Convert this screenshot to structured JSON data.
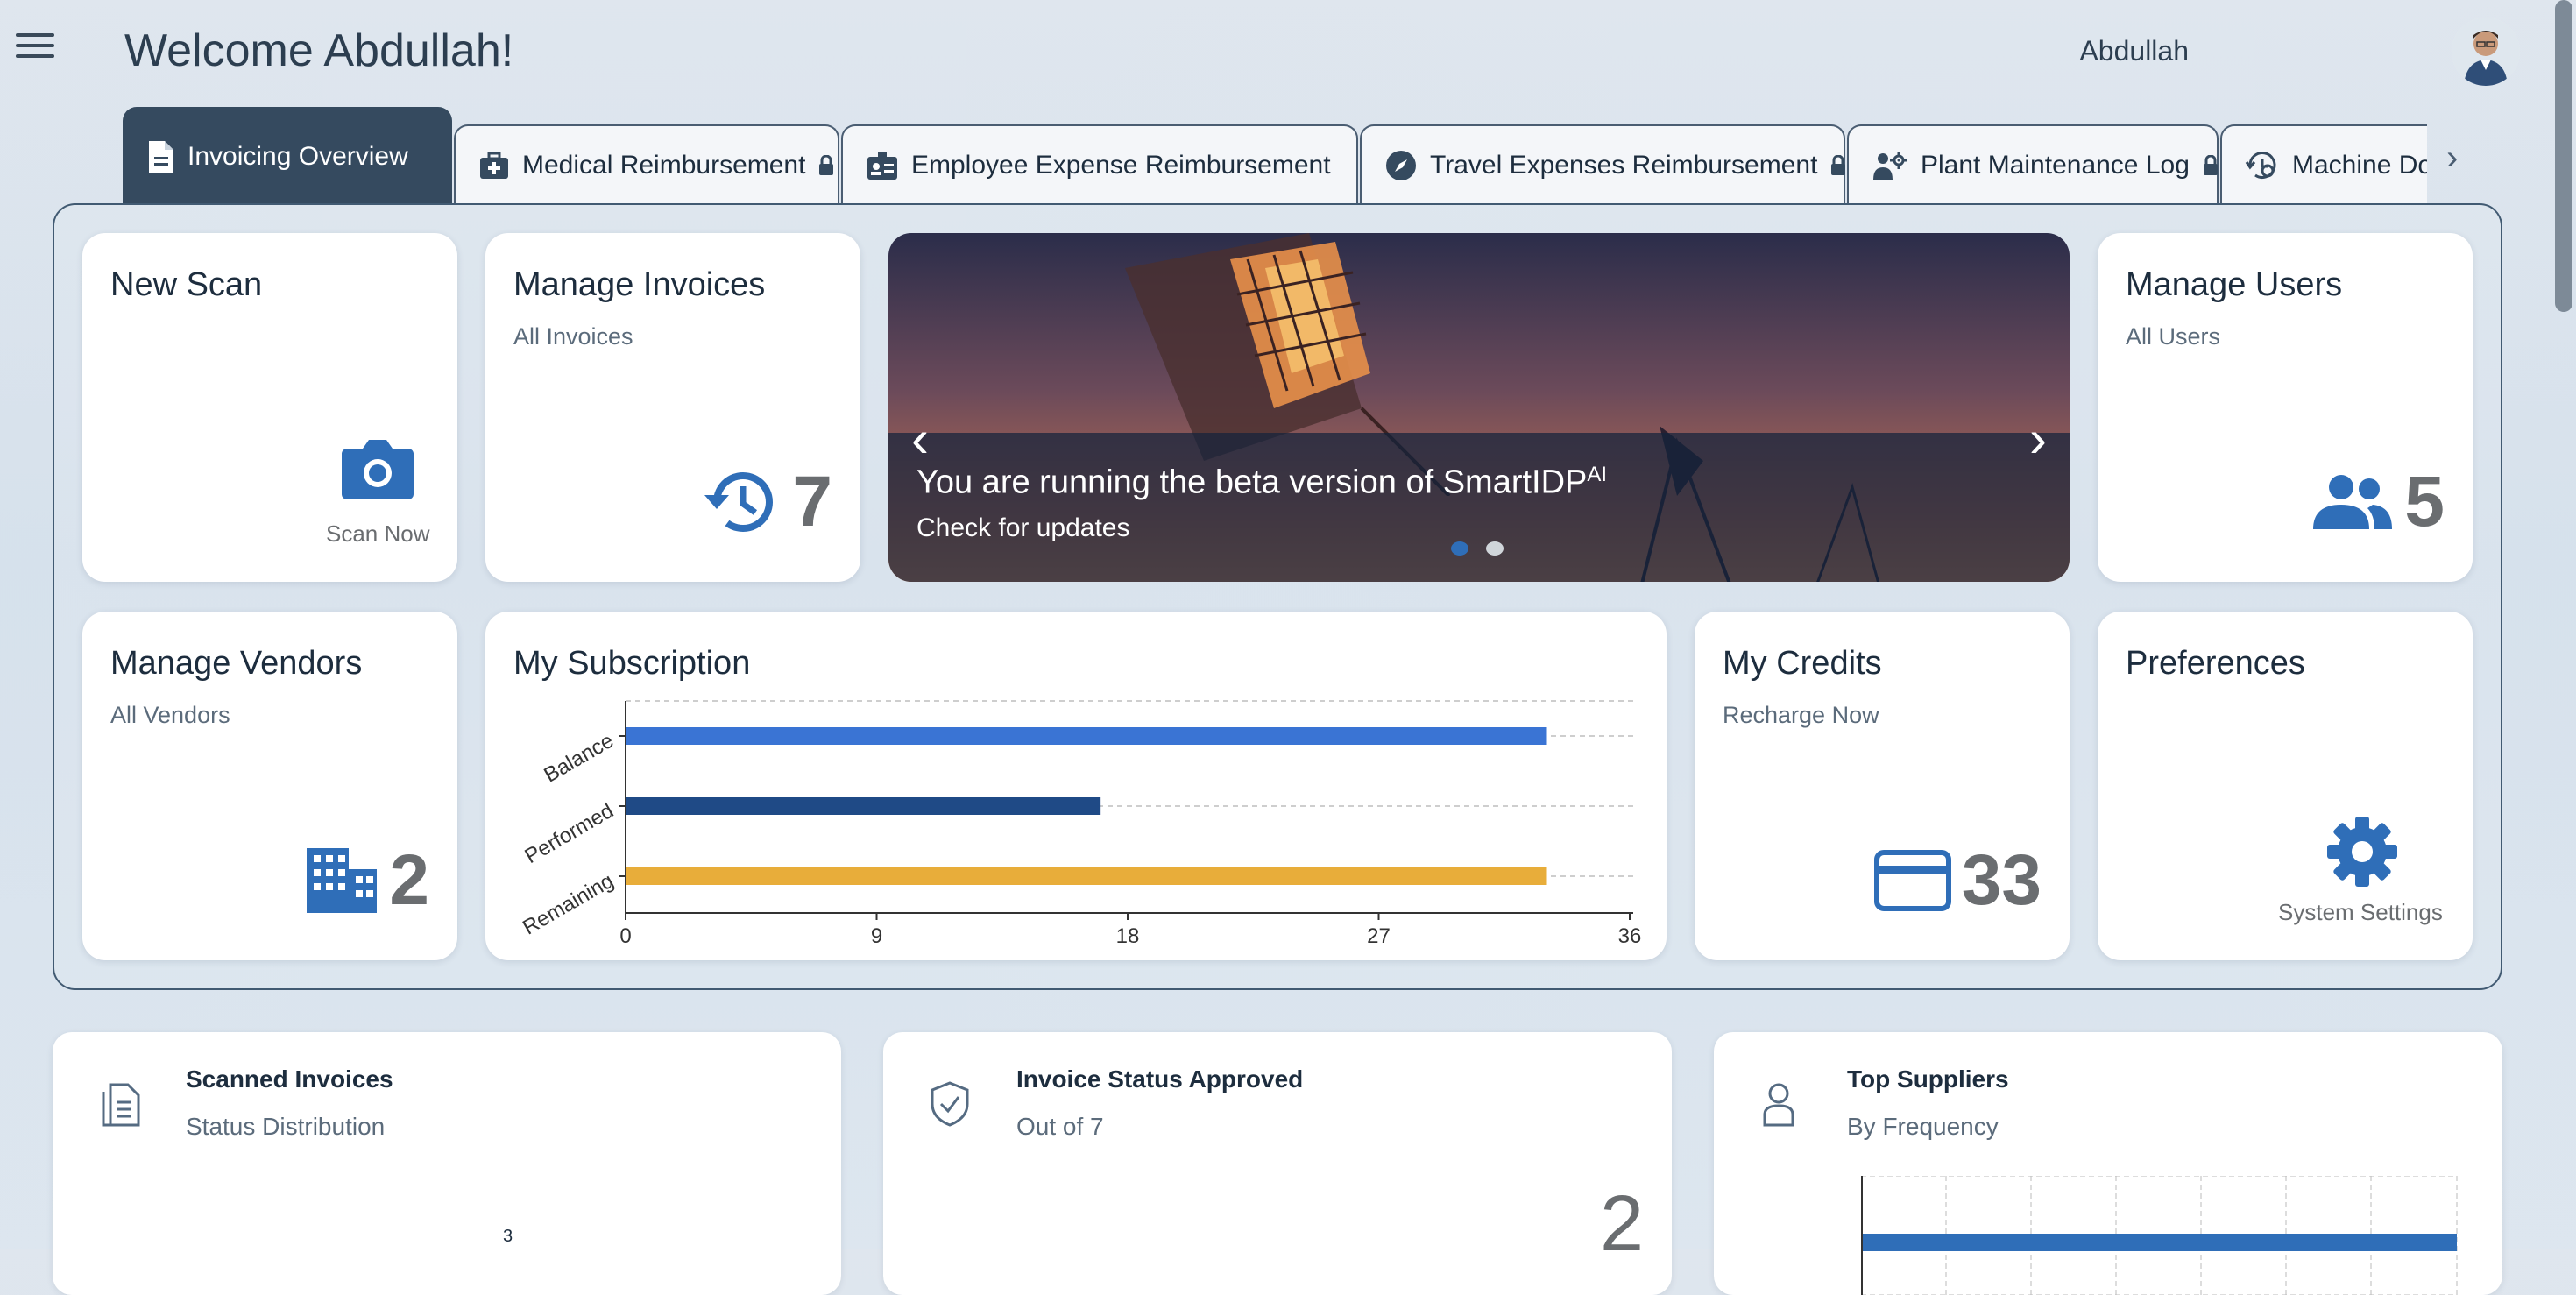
{
  "header": {
    "welcome": "Welcome Abdullah!",
    "user_name": "Abdullah"
  },
  "tabs": [
    {
      "label": "Invoicing Overview"
    },
    {
      "label": "Medical Reimbursement"
    },
    {
      "label": "Employee Expense Reimbursement"
    },
    {
      "label": "Travel Expenses Reimbursement"
    },
    {
      "label": "Plant Maintenance Log"
    },
    {
      "label": "Machine Do"
    }
  ],
  "cards": {
    "new_scan": {
      "title": "New Scan",
      "action": "Scan Now"
    },
    "manage_invoices": {
      "title": "Manage Invoices",
      "sub": "All Invoices",
      "count": "7"
    },
    "manage_users": {
      "title": "Manage Users",
      "sub": "All Users",
      "count": "5"
    },
    "manage_vendors": {
      "title": "Manage Vendors",
      "sub": "All Vendors",
      "count": "2"
    },
    "subscription": {
      "title": "My Subscription"
    },
    "credits": {
      "title": "My Credits",
      "sub": "Recharge Now",
      "count": "33"
    },
    "preferences": {
      "title": "Preferences",
      "action": "System Settings"
    }
  },
  "carousel": {
    "text": "You are running the beta version of SmartIDP",
    "sup": "AI",
    "link": "Check for updates"
  },
  "bottom": {
    "scanned": {
      "title": "Scanned Invoices",
      "sub": "Status Distribution",
      "value": "3"
    },
    "approved": {
      "title": "Invoice Status Approved",
      "sub": "Out of 7",
      "value": "2"
    },
    "suppliers": {
      "title": "Top Suppliers",
      "sub": "By Frequency"
    }
  },
  "chart_data": {
    "type": "bar",
    "orientation": "horizontal",
    "categories": [
      "Balance",
      "Performed",
      "Remaining"
    ],
    "values": [
      33,
      17,
      33
    ],
    "colors": [
      "#3a74d4",
      "#1f4a86",
      "#e8ad3a"
    ],
    "xticks": [
      "0",
      "9",
      "18",
      "27",
      "36"
    ],
    "xlim": [
      0,
      36
    ],
    "grid": true
  }
}
